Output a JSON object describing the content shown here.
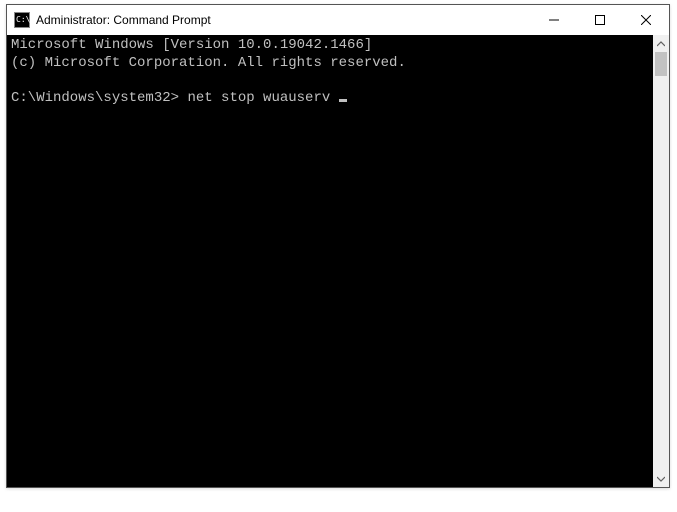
{
  "window": {
    "title": "Administrator: Command Prompt"
  },
  "terminal": {
    "line1": "Microsoft Windows [Version 10.0.19042.1466]",
    "line2": "(c) Microsoft Corporation. All rights reserved.",
    "prompt": "C:\\Windows\\system32>",
    "command": "net stop wuauserv"
  }
}
